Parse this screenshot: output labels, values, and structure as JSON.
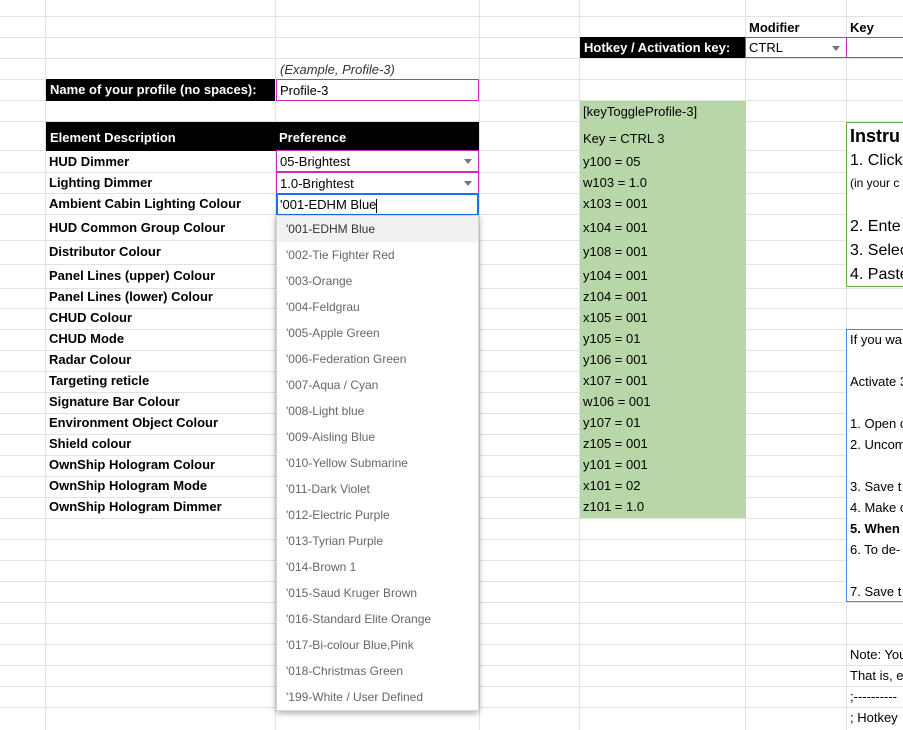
{
  "header": {
    "modifier_label": "Modifier",
    "key_label": "Key",
    "hotkey_label": "Hotkey / Activation key:",
    "modifier_value": "CTRL"
  },
  "profile": {
    "example": "(Example, Profile-3)",
    "name_label": "Name of your profile (no spaces):",
    "name_value": "Profile-3"
  },
  "table": {
    "col_description": "Element Description",
    "col_preference": "Preference",
    "rows": [
      {
        "label": "HUD Dimmer",
        "value": "05-Brightest"
      },
      {
        "label": "Lighting Dimmer",
        "value": "1.0-Brightest"
      },
      {
        "label": "Ambient Cabin Lighting Colour",
        "value": "'001-EDHM Blue"
      },
      {
        "label": "HUD Common Group Colour"
      },
      {
        "label": "Distributor Colour"
      },
      {
        "label": "Panel Lines (upper) Colour"
      },
      {
        "label": "Panel Lines (lower) Colour"
      },
      {
        "label": "CHUD Colour"
      },
      {
        "label": "CHUD Mode"
      },
      {
        "label": "Radar Colour"
      },
      {
        "label": "Targeting reticle"
      },
      {
        "label": "Signature Bar Colour"
      },
      {
        "label": "Environment Object Colour"
      },
      {
        "label": "Shield colour"
      },
      {
        "label": "OwnShip Hologram Colour"
      },
      {
        "label": "OwnShip Hologram Mode"
      },
      {
        "label": "OwnShip Hologram Dimmer"
      }
    ]
  },
  "dropdown": {
    "options": [
      "'001-EDHM Blue",
      "'002-Tie Fighter Red",
      "'003-Orange",
      "'004-Feldgrau",
      "'005-Apple Green",
      "'006-Federation Green",
      "'007-Aqua / Cyan",
      "'008-Light blue",
      "'009-Aisling Blue",
      "'010-Yellow Submarine",
      "'011-Dark Violet",
      "'012-Electric Purple",
      "'013-Tyrian Purple",
      "'014-Brown 1",
      "'015-Saud Kruger Brown",
      "'016-Standard Elite Orange",
      "'017-Bi-colour Blue,Pink",
      "'018-Christmas Green",
      "'199-White / User Defined"
    ]
  },
  "code": {
    "toggle": "[keyToggleProfile-3]",
    "key": "Key = CTRL 3",
    "lines": [
      "y100 = 05",
      "w103 = 1.0",
      "x103 = 001",
      "x104 = 001",
      "y108 = 001",
      "y104 = 001",
      "z104 = 001",
      "x105 = 001",
      "y105 = 01",
      "y106 = 001",
      "x107 = 001",
      "w106 = 001",
      "y107 = 01",
      "z105 = 001",
      "y101 = 001",
      "x101 = 02",
      "z101 = 1.0"
    ]
  },
  "right_panel": {
    "instructions_title": "Instru",
    "box1": [
      "1. Click",
      "(in your c",
      "2. Ente",
      "3. Selec",
      "4. Paste"
    ],
    "box2": [
      "If you wa",
      "Activate 3",
      "1. Open c",
      "2. Uncom",
      "3. Save t",
      "4. Make c",
      "5. When",
      "6. To de-",
      "7. Save t"
    ],
    "notes": [
      "Note: You",
      "That is, e",
      ";----------",
      "; Hotkey"
    ]
  },
  "colors": {
    "green": "#b7d7a8",
    "magenta_border": "#c62bc6",
    "active_blue": "#1a73e8"
  }
}
